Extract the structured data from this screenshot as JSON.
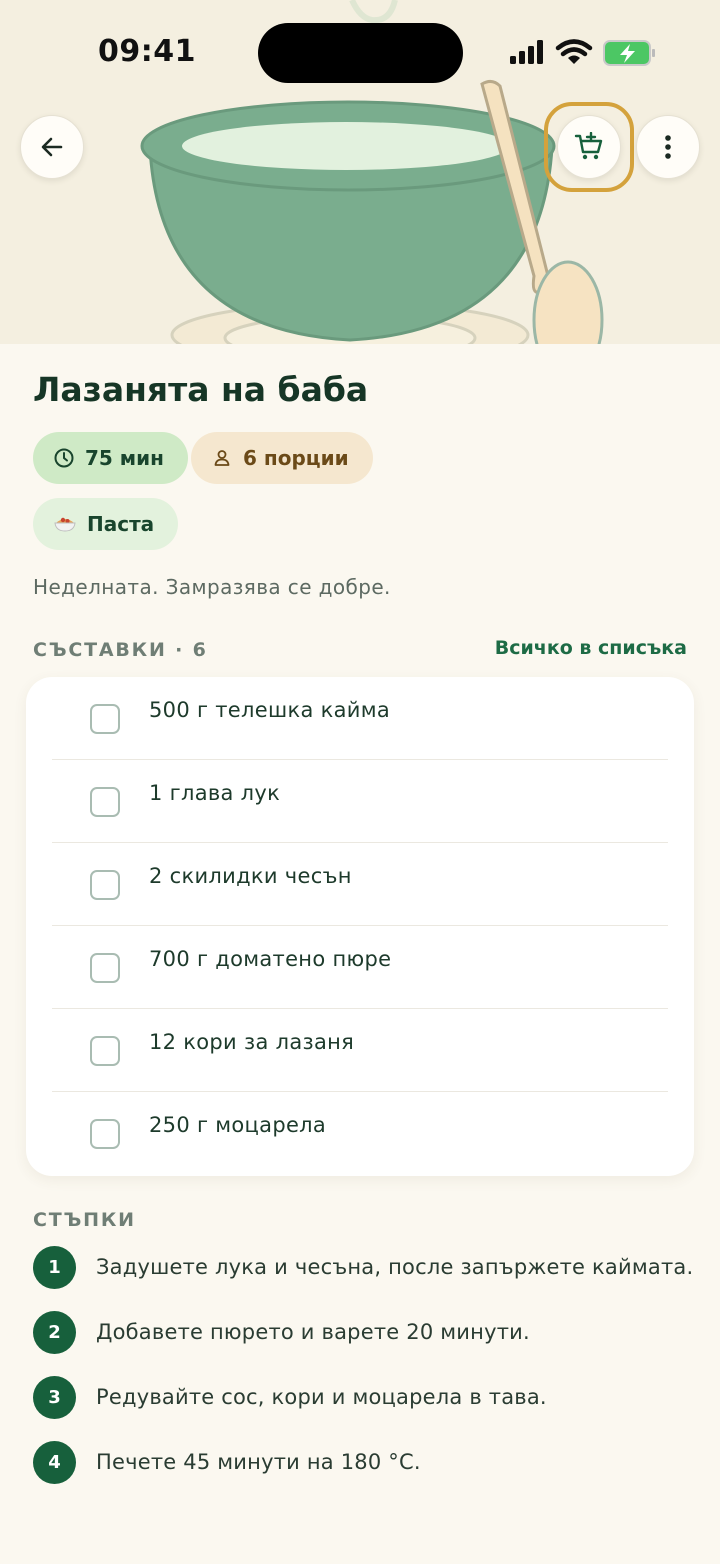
{
  "status_bar": {
    "time": "09:41",
    "icons": [
      "cellular-signal-icon",
      "wifi-icon",
      "battery-charging-icon"
    ]
  },
  "header": {
    "back_icon": "arrow-left-icon",
    "cart_icon": "cart-plus-icon",
    "more_icon": "more-vertical-icon",
    "accent_color": "#d4a23c"
  },
  "recipe": {
    "title": "Лазанята на баба",
    "time": "75 мин",
    "portions": "6 порции",
    "category": "Паста",
    "description": "Неделната. Замразява се добре."
  },
  "ingredients": {
    "label": "СЪСТАВКИ · 6",
    "action_label": "Всичко в списъка",
    "items": [
      "500 г телешка кайма",
      "1 глава лук",
      "2 скилидки чесън",
      "700 г доматено пюре",
      "12 кори за лазаня",
      "250 г моцарела"
    ]
  },
  "steps": {
    "label": "СТЪПКИ",
    "items": [
      {
        "num": "1",
        "text": "Задушете лука и чесъна, после запържете каймата."
      },
      {
        "num": "2",
        "text": "Добавете пюрето и варете 20 минути."
      },
      {
        "num": "3",
        "text": "Редувайте сос, кори и моцарела в тава."
      },
      {
        "num": "4",
        "text": "Печете 45 минути на 180 °C."
      }
    ]
  },
  "colors": {
    "primary": "#17603c",
    "background": "#fbf8f0",
    "chip_time": "#cfeac6",
    "chip_portions": "#f5e7cf"
  }
}
